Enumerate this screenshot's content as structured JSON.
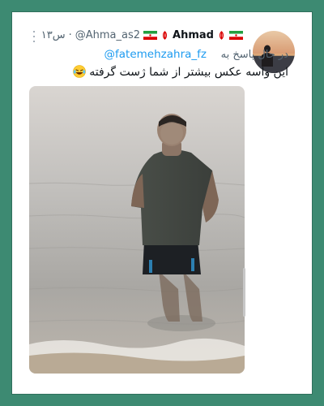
{
  "tweet": {
    "display_name": "Ahmad",
    "handle": "@Ahma_as2",
    "time": "۱۳س",
    "separator": "·",
    "reply_prefix": "در حال پاسخ به",
    "reply_to": "@fatemehzahra_fz",
    "text": "این واسه عکس بیشتر از شما ژست گرفته"
  },
  "icons": {
    "menu": "more-icon",
    "flag": "iran-flag-icon",
    "emoji": "laughing-tears-emoji-icon",
    "name_badge": "iran-emblem-icon"
  },
  "colors": {
    "background": "#3d8a72",
    "link": "#1d9bf0",
    "secondary_text": "#536471",
    "primary_text": "#0f1419"
  }
}
